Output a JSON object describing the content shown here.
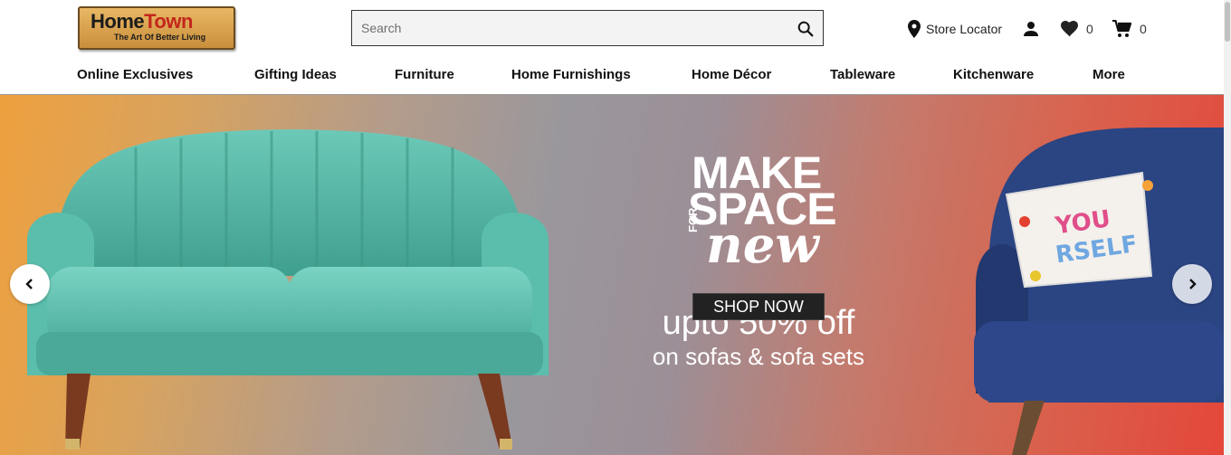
{
  "header": {
    "logo": {
      "brand_part1": "Home",
      "brand_part2": "Town",
      "tagline": "The Art Of Better Living"
    },
    "search": {
      "placeholder": "Search",
      "value": ""
    },
    "store_locator_label": "Store Locator",
    "wishlist_count": "0",
    "cart_count": "0"
  },
  "nav": {
    "items": [
      {
        "label": "Online Exclusives"
      },
      {
        "label": "Gifting Ideas"
      },
      {
        "label": "Furniture"
      },
      {
        "label": "Home Furnishings"
      },
      {
        "label": "Home Décor"
      },
      {
        "label": "Tableware"
      },
      {
        "label": "Kitchenware"
      },
      {
        "label": "More"
      }
    ]
  },
  "hero": {
    "headline_line1": "MAKE",
    "headline_line2": "SPACE",
    "headline_for": "FOR",
    "headline_new": "new",
    "offer": "upto 50% off",
    "offer_sub": "on sofas & sofa sets",
    "cta_label": "SHOP NOW"
  },
  "colors": {
    "accent_brand": "#c4261c",
    "hero_left": "#eea03e",
    "hero_right": "#e4473a",
    "sofa_teal": "#4fb5a3",
    "chair_navy": "#27407a"
  },
  "icons": [
    "search-icon",
    "map-pin-icon",
    "user-icon",
    "heart-icon",
    "cart-icon",
    "chevron-left-icon",
    "chevron-right-icon"
  ]
}
